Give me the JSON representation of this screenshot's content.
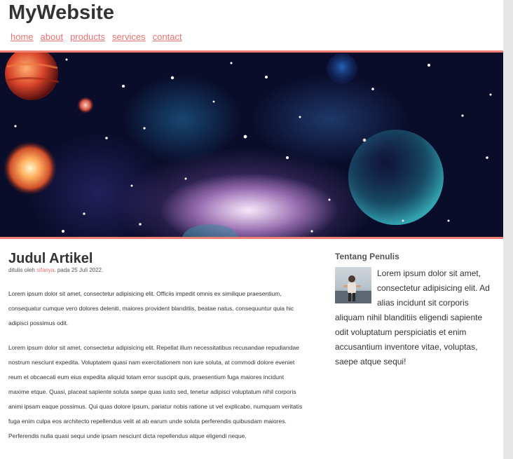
{
  "site": {
    "title": "MyWebsite"
  },
  "nav": {
    "items": [
      "home",
      "about",
      "products",
      "services",
      "contact"
    ]
  },
  "article": {
    "title": "Judul Artikel",
    "byline_prefix": "ditulis oleh ",
    "author": "sifanya",
    "byline_suffix": ". pada 25 Juli 2022.",
    "paragraphs": [
      "Lorem ipsum dolor sit amet, consectetur adipisicing elit. Officiis impedit omnis ex similique praesentium, consequatur cumque vero dolores deleniti, maiores provident blanditiis, beatae natus, consequuntur quia hic adipisci possimus odit.",
      "Lorem ipsum dolor sit amet, consectetur adipisicing elit. Repellat illum necessitatibus recusandae repudiandae nostrum nesciunt expedita. Voluptatem quasi nam exercitationem non iure soluta, at commodi dolore eveniet reum et obcaecati eum eius expedita aliquid totam error suscipit quis, praesentium fuga maiores incidunt maxime etque. Quasi, placeat sapiente soluta saepe quas iusto sed, tenetur adipisci voluptatum nihil corporis animi ipsam eaque possimus. Qui quas dolore ipsum, pariatur nobis ratione ut vel explicabo, numquam veritatis fuga enim culpa eos architecto repellendus velit at ab earum unde soluta perferendis quibusdam maiores. Perferendis nulla quasi sequi unde ipsam nesciunt dicta repellendus atque eligendi neque."
    ]
  },
  "sidebar": {
    "heading": "Tentang Penulis",
    "bio": "Lorem ipsum dolor sit amet, consectetur adipisicing elit. Ad alias incidunt sit corporis aliquam nihil blanditiis eligendi sapiente odit voluptatum perspiciatis et enim accusantium inventore vitae, voluptas, saepe atque sequi!"
  },
  "colors": {
    "accent": "#ef7f72",
    "link": "#e57373",
    "text": "#333333"
  }
}
